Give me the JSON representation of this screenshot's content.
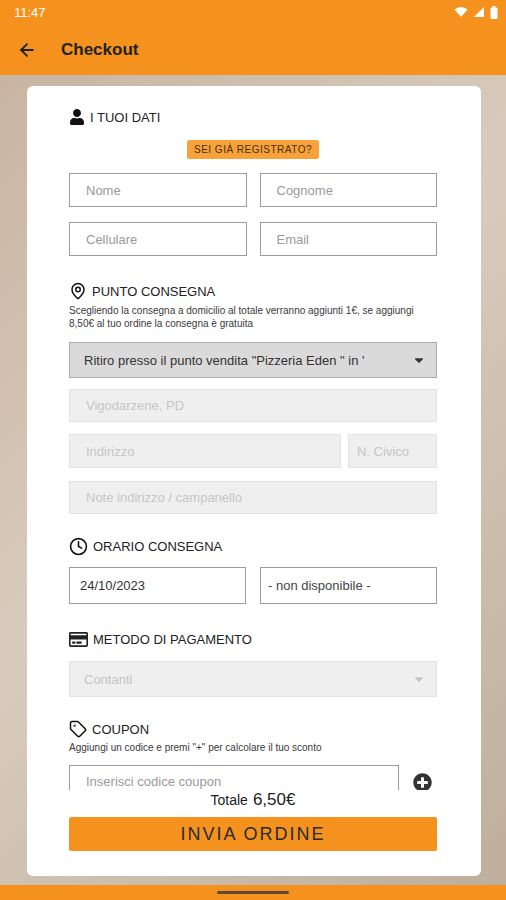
{
  "status_bar": {
    "time": "11:47"
  },
  "app_bar": {
    "title": "Checkout"
  },
  "personal": {
    "title": "I TUOI DATI",
    "login_button": "SEI GIÀ REGISTRATO?",
    "fields": [
      {
        "placeholder": "Nome",
        "value": "",
        "disabled": false
      },
      {
        "placeholder": "Cognome",
        "value": "",
        "disabled": false
      },
      {
        "placeholder": "Cellulare",
        "value": "",
        "disabled": false
      },
      {
        "placeholder": "Email",
        "value": "",
        "disabled": false
      }
    ]
  },
  "delivery": {
    "title": "PUNTO CONSEGNA",
    "note": "Scegliendo la consegna a domicilio al totale verranno aggiunti 1€, se aggiungi 8,50€ al tuo ordine la consegna è gratuita",
    "mode": {
      "value": "Ritiro presso il punto vendita \"Pizzeria Eden \" in '",
      "disabled": false
    },
    "fields": [
      {
        "placeholder": "",
        "value": "Vigodarzene, PD",
        "disabled": true
      },
      {
        "placeholder": "Indirizzo",
        "value": "",
        "disabled": true
      },
      {
        "placeholder": "N. Civico",
        "value": "",
        "disabled": true
      },
      {
        "placeholder": "Note indirizzo / campanello",
        "value": "",
        "disabled": true
      }
    ]
  },
  "schedule": {
    "title": "ORARIO CONSEGNA",
    "date": "24/10/2023",
    "time": "- non disponibile -"
  },
  "payment": {
    "title": "METODO DI PAGAMENTO",
    "method": {
      "value": "Contanti",
      "disabled": true
    }
  },
  "coupon": {
    "title": "COUPON",
    "note": "Aggiungi un codice e premi \"+\" per calcolare il tuo sconto",
    "field": {
      "placeholder": "Inserisci codice coupon",
      "value": "",
      "disabled": false
    }
  },
  "total": {
    "label": "Totale",
    "amount": "6,50€"
  },
  "submit_button": "INVIA ORDINE"
}
